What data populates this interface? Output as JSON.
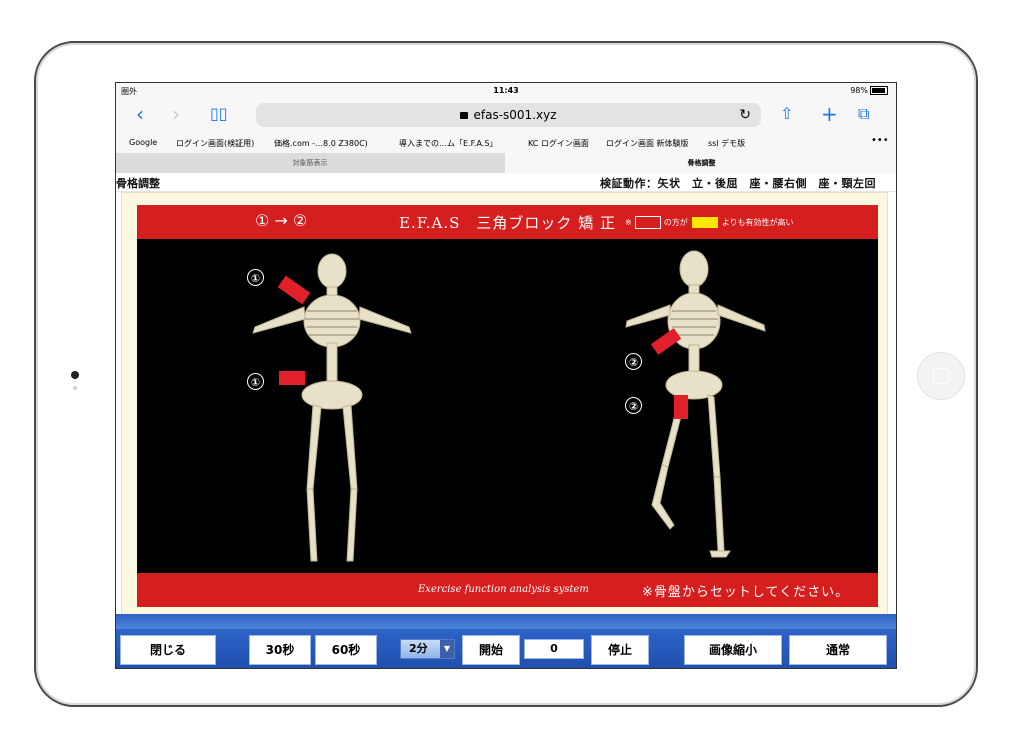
{
  "status": {
    "carrier": "圏外",
    "time": "11:43",
    "battery": "98%"
  },
  "browser": {
    "url": "efas-s001.xyz",
    "bookmarks": [
      "Google",
      "ログイン画面(検証用)",
      "価格.com -…8.0 Z380C)",
      "導入までの…ム「E.F.A.S」",
      "KC ログイン画面",
      "ログイン画面 新体験版",
      "ssl デモ版"
    ],
    "tabs": [
      "対象筋表示",
      "骨格調整"
    ]
  },
  "page": {
    "title": "骨格調整",
    "verify": "検証動作：矢状　立・後屈　座・腰右側　座・頸左回"
  },
  "efas": {
    "sequence": "① → ②",
    "title": "E.F.A.S　三角ブロック 矯 正",
    "note_prefix": "※",
    "note_mid": "の方が",
    "note_suffix": "よりも有効性が高い",
    "footer_en": "Exercise  function analysis system",
    "footer_jp": "※骨盤からセットしてください。",
    "markers": [
      "①",
      "①",
      "②",
      "②"
    ],
    "colors": {
      "red": "#d51e1e",
      "yellow": "#ffe800"
    }
  },
  "toolbar": {
    "close": "閉じる",
    "sec30": "30秒",
    "sec60": "60秒",
    "duration": "2分",
    "start": "開始",
    "counter": "0",
    "stop": "停止",
    "shrink": "画像縮小",
    "normal": "通常"
  }
}
